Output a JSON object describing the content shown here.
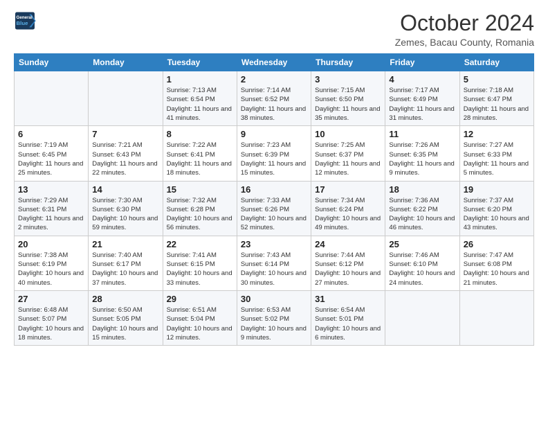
{
  "header": {
    "logo": {
      "line1": "General",
      "line2": "Blue"
    },
    "title": "October 2024",
    "subtitle": "Zemes, Bacau County, Romania"
  },
  "weekdays": [
    "Sunday",
    "Monday",
    "Tuesday",
    "Wednesday",
    "Thursday",
    "Friday",
    "Saturday"
  ],
  "weeks": [
    [
      {
        "day": "",
        "detail": ""
      },
      {
        "day": "",
        "detail": ""
      },
      {
        "day": "1",
        "detail": "Sunrise: 7:13 AM\nSunset: 6:54 PM\nDaylight: 11 hours and 41 minutes."
      },
      {
        "day": "2",
        "detail": "Sunrise: 7:14 AM\nSunset: 6:52 PM\nDaylight: 11 hours and 38 minutes."
      },
      {
        "day": "3",
        "detail": "Sunrise: 7:15 AM\nSunset: 6:50 PM\nDaylight: 11 hours and 35 minutes."
      },
      {
        "day": "4",
        "detail": "Sunrise: 7:17 AM\nSunset: 6:49 PM\nDaylight: 11 hours and 31 minutes."
      },
      {
        "day": "5",
        "detail": "Sunrise: 7:18 AM\nSunset: 6:47 PM\nDaylight: 11 hours and 28 minutes."
      }
    ],
    [
      {
        "day": "6",
        "detail": "Sunrise: 7:19 AM\nSunset: 6:45 PM\nDaylight: 11 hours and 25 minutes."
      },
      {
        "day": "7",
        "detail": "Sunrise: 7:21 AM\nSunset: 6:43 PM\nDaylight: 11 hours and 22 minutes."
      },
      {
        "day": "8",
        "detail": "Sunrise: 7:22 AM\nSunset: 6:41 PM\nDaylight: 11 hours and 18 minutes."
      },
      {
        "day": "9",
        "detail": "Sunrise: 7:23 AM\nSunset: 6:39 PM\nDaylight: 11 hours and 15 minutes."
      },
      {
        "day": "10",
        "detail": "Sunrise: 7:25 AM\nSunset: 6:37 PM\nDaylight: 11 hours and 12 minutes."
      },
      {
        "day": "11",
        "detail": "Sunrise: 7:26 AM\nSunset: 6:35 PM\nDaylight: 11 hours and 9 minutes."
      },
      {
        "day": "12",
        "detail": "Sunrise: 7:27 AM\nSunset: 6:33 PM\nDaylight: 11 hours and 5 minutes."
      }
    ],
    [
      {
        "day": "13",
        "detail": "Sunrise: 7:29 AM\nSunset: 6:31 PM\nDaylight: 11 hours and 2 minutes."
      },
      {
        "day": "14",
        "detail": "Sunrise: 7:30 AM\nSunset: 6:30 PM\nDaylight: 10 hours and 59 minutes."
      },
      {
        "day": "15",
        "detail": "Sunrise: 7:32 AM\nSunset: 6:28 PM\nDaylight: 10 hours and 56 minutes."
      },
      {
        "day": "16",
        "detail": "Sunrise: 7:33 AM\nSunset: 6:26 PM\nDaylight: 10 hours and 52 minutes."
      },
      {
        "day": "17",
        "detail": "Sunrise: 7:34 AM\nSunset: 6:24 PM\nDaylight: 10 hours and 49 minutes."
      },
      {
        "day": "18",
        "detail": "Sunrise: 7:36 AM\nSunset: 6:22 PM\nDaylight: 10 hours and 46 minutes."
      },
      {
        "day": "19",
        "detail": "Sunrise: 7:37 AM\nSunset: 6:20 PM\nDaylight: 10 hours and 43 minutes."
      }
    ],
    [
      {
        "day": "20",
        "detail": "Sunrise: 7:38 AM\nSunset: 6:19 PM\nDaylight: 10 hours and 40 minutes."
      },
      {
        "day": "21",
        "detail": "Sunrise: 7:40 AM\nSunset: 6:17 PM\nDaylight: 10 hours and 37 minutes."
      },
      {
        "day": "22",
        "detail": "Sunrise: 7:41 AM\nSunset: 6:15 PM\nDaylight: 10 hours and 33 minutes."
      },
      {
        "day": "23",
        "detail": "Sunrise: 7:43 AM\nSunset: 6:14 PM\nDaylight: 10 hours and 30 minutes."
      },
      {
        "day": "24",
        "detail": "Sunrise: 7:44 AM\nSunset: 6:12 PM\nDaylight: 10 hours and 27 minutes."
      },
      {
        "day": "25",
        "detail": "Sunrise: 7:46 AM\nSunset: 6:10 PM\nDaylight: 10 hours and 24 minutes."
      },
      {
        "day": "26",
        "detail": "Sunrise: 7:47 AM\nSunset: 6:08 PM\nDaylight: 10 hours and 21 minutes."
      }
    ],
    [
      {
        "day": "27",
        "detail": "Sunrise: 6:48 AM\nSunset: 5:07 PM\nDaylight: 10 hours and 18 minutes."
      },
      {
        "day": "28",
        "detail": "Sunrise: 6:50 AM\nSunset: 5:05 PM\nDaylight: 10 hours and 15 minutes."
      },
      {
        "day": "29",
        "detail": "Sunrise: 6:51 AM\nSunset: 5:04 PM\nDaylight: 10 hours and 12 minutes."
      },
      {
        "day": "30",
        "detail": "Sunrise: 6:53 AM\nSunset: 5:02 PM\nDaylight: 10 hours and 9 minutes."
      },
      {
        "day": "31",
        "detail": "Sunrise: 6:54 AM\nSunset: 5:01 PM\nDaylight: 10 hours and 6 minutes."
      },
      {
        "day": "",
        "detail": ""
      },
      {
        "day": "",
        "detail": ""
      }
    ]
  ]
}
